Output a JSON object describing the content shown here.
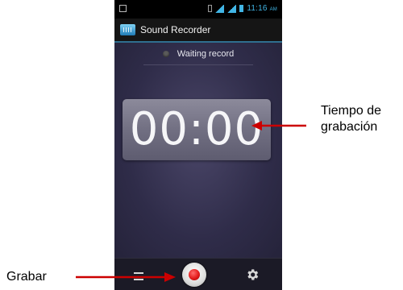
{
  "status_bar": {
    "time": "11:16",
    "ampm": "AM"
  },
  "action_bar": {
    "title": "Sound Recorder"
  },
  "recorder": {
    "status_text": "Waiting record",
    "timer": "00:00"
  },
  "bottom_bar": {
    "icons": [
      "menu-icon",
      "record-icon",
      "gear-icon"
    ]
  },
  "annotations": {
    "timer_label_line1": "Tiempo de",
    "timer_label_line2": "grabación",
    "record_label": "Grabar",
    "arrow_color": "#cc0000"
  }
}
